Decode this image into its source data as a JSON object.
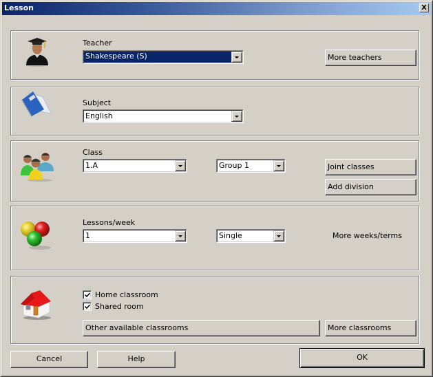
{
  "window": {
    "title": "Lesson",
    "close_label": "X"
  },
  "teacher": {
    "icon": "teacher-graduate-icon",
    "label": "Teacher",
    "value": "Shakespeare (S)",
    "more_button": "More teachers"
  },
  "subject": {
    "icon": "notebook-icon",
    "label": "Subject",
    "value": "English"
  },
  "class_section": {
    "icon": "students-group-icon",
    "label": "Class",
    "value": "1.A",
    "group_value": "Group 1",
    "joint_button": "Joint classes",
    "division_button": "Add division"
  },
  "lessons": {
    "icon": "colored-balls-icon",
    "label": "Lessons/week",
    "value": "1",
    "length_value": "Single",
    "more_button": "More weeks/terms"
  },
  "rooms": {
    "icon": "house-icon",
    "home_classroom": {
      "label": "Home classroom",
      "checked": true
    },
    "shared_room": {
      "label": "Shared room",
      "checked": true
    },
    "other_button": "Other available classrooms",
    "more_button": "More classrooms"
  },
  "footer": {
    "cancel": "Cancel",
    "help": "Help",
    "ok": "OK"
  }
}
